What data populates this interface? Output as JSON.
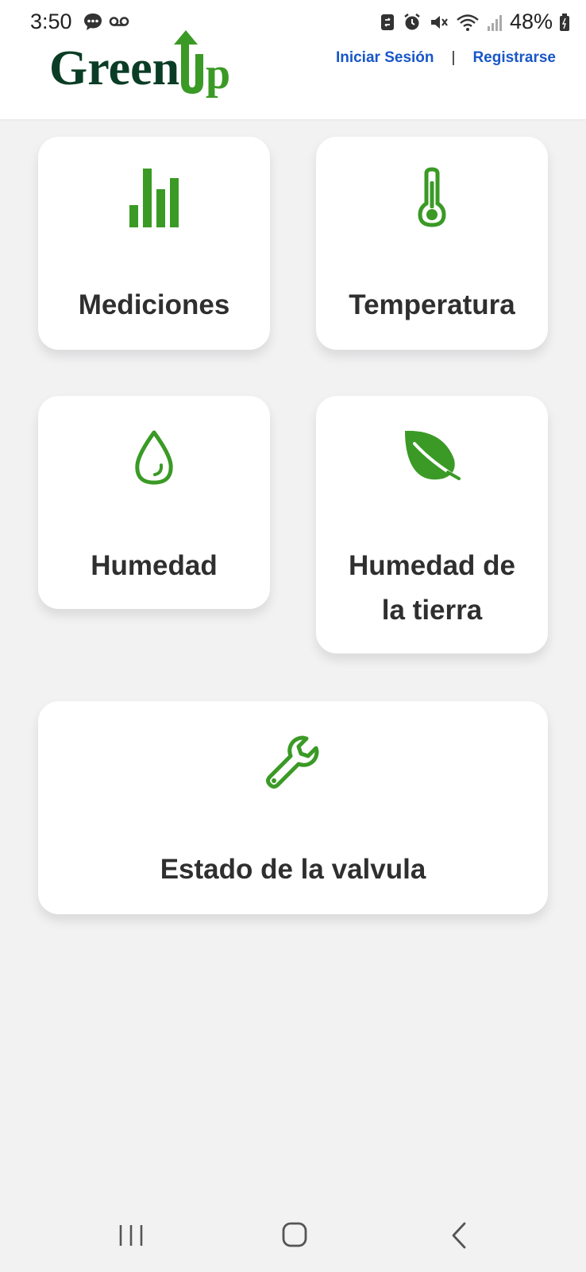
{
  "status_bar": {
    "time": "3:50",
    "battery": "48%",
    "left_icons": [
      "chat-bubble-icon",
      "voicemail-icon"
    ],
    "right_icons": [
      "sync-icon",
      "alarm-icon",
      "mute-icon",
      "wifi-icon",
      "signal-icon",
      "battery-icon"
    ]
  },
  "header": {
    "logo_text": "GreenUp",
    "login_label": "Iniciar Sesión",
    "separator": "|",
    "register_label": "Registrarse"
  },
  "colors": {
    "accent_green": "#3a9a25",
    "logo_dark_green": "#0b3d26",
    "link_blue": "#1857c7",
    "background": "#f2f2f3"
  },
  "cards": [
    {
      "label": "Mediciones",
      "icon": "bar-chart-icon"
    },
    {
      "label": "Temperatura",
      "icon": "thermometer-icon"
    },
    {
      "label": "Humedad",
      "icon": "water-drop-icon"
    },
    {
      "label_line1": "Humedad de",
      "label_line2": "la tierra",
      "icon": "leaf-icon"
    },
    {
      "label": "Estado de la valvula",
      "icon": "wrench-icon"
    }
  ],
  "nav": {
    "buttons": [
      "recent-apps-icon",
      "home-icon",
      "back-icon"
    ]
  }
}
